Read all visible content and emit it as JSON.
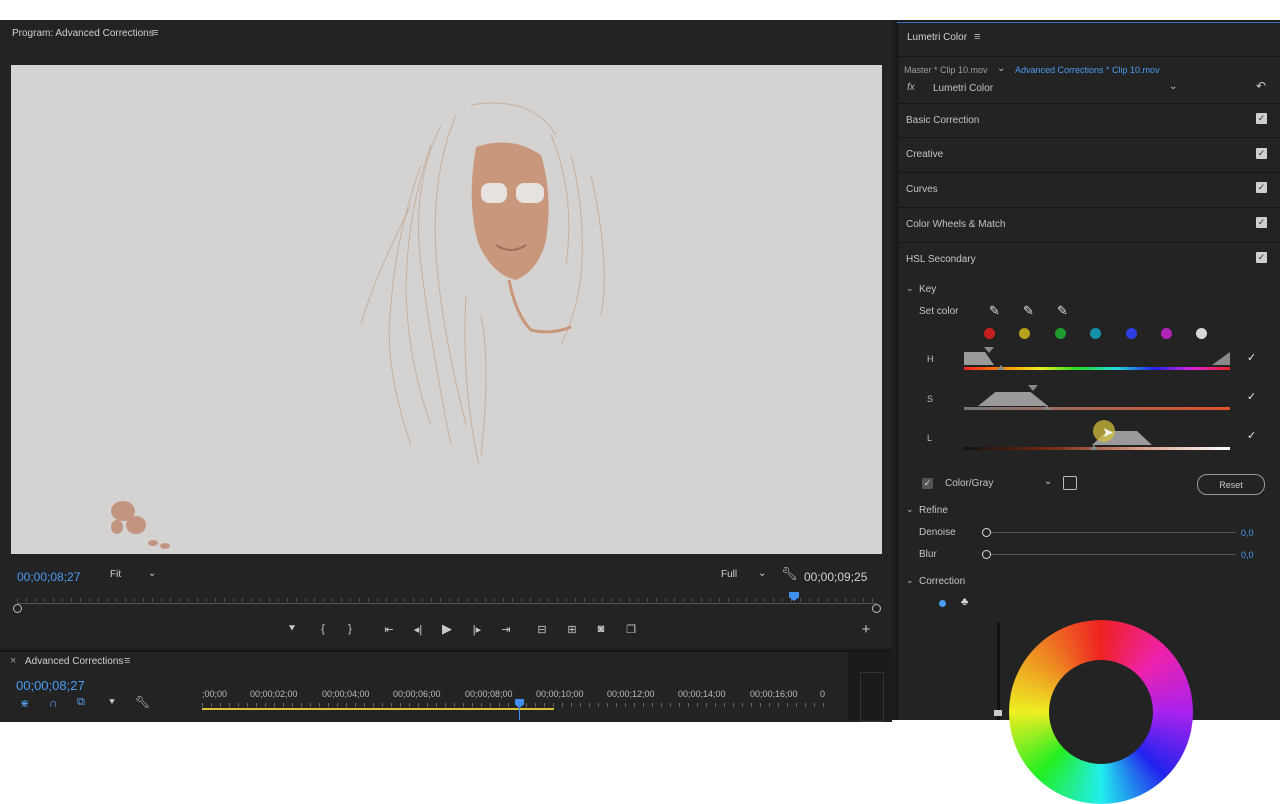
{
  "program": {
    "title": "Program: Advanced Corrections",
    "timecode_current": "00;00;08;27",
    "fit": "Fit",
    "quality": "Full",
    "timecode_duration": "00;00;09;25"
  },
  "timeline": {
    "title": "Advanced Corrections",
    "timecode": "00;00;08;27",
    "ruler": [
      ";00;00",
      "00;00;02;00",
      "00;00;04;00",
      "00;00;06;00",
      "00;00;08;00",
      "00;00;10;00",
      "00;00;12;00",
      "00;00;14;00",
      "00;00;16;00",
      "0"
    ]
  },
  "lumetri": {
    "title": "Lumetri Color",
    "master_clip": "Master * Clip 10.mov",
    "active_clip": "Advanced Corrections * Clip 10.mov",
    "fx_label": "fx",
    "effect": "Lumetri Color",
    "sections": [
      "Basic Correction",
      "Creative",
      "Curves",
      "Color Wheels & Match",
      "HSL Secondary"
    ],
    "key": {
      "title": "Key",
      "set_color": "Set color",
      "swatch_colors": [
        "#c41e1e",
        "#b5a21a",
        "#1f9c2f",
        "#1592a8",
        "#2d3fe0",
        "#b024b8",
        "#d8d8d8"
      ],
      "sliders": [
        "H",
        "S",
        "L"
      ]
    },
    "colorgray": "Color/Gray",
    "reset": "Reset",
    "refine": {
      "title": "Refine",
      "denoise_label": "Denoise",
      "denoise_value": "0,0",
      "blur_label": "Blur",
      "blur_value": "0,0"
    },
    "correction": {
      "title": "Correction"
    }
  }
}
